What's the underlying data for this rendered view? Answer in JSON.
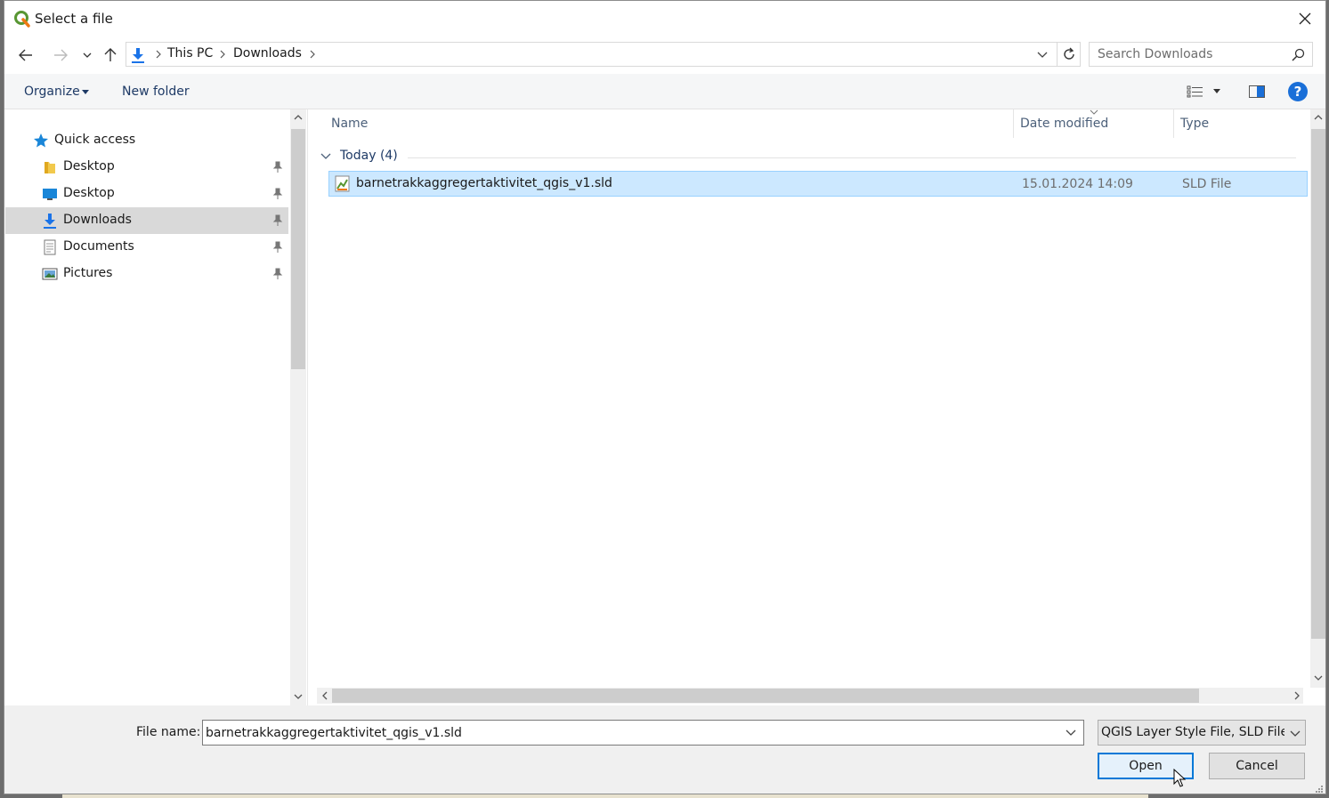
{
  "window": {
    "title": "Select a file"
  },
  "navigation": {
    "back_icon": "back-arrow-icon",
    "forward_icon": "forward-arrow-icon",
    "recent_icon": "chevron-down-icon",
    "up_icon": "up-arrow-icon",
    "breadcrumb": [
      "This PC",
      "Downloads"
    ],
    "search_placeholder": "Search Downloads"
  },
  "toolbar": {
    "organize": "Organize",
    "new_folder": "New folder"
  },
  "sidebar": {
    "items": [
      {
        "label": "Quick access",
        "icon": "star-icon"
      },
      {
        "label": "Desktop",
        "icon": "folder-icon"
      },
      {
        "label": "Desktop",
        "icon": "desktop-icon"
      },
      {
        "label": "Downloads",
        "icon": "download-icon"
      },
      {
        "label": "Documents",
        "icon": "document-icon"
      },
      {
        "label": "Pictures",
        "icon": "pictures-icon"
      }
    ]
  },
  "files": {
    "columns": {
      "name": "Name",
      "date": "Date modified",
      "type": "Type"
    },
    "group": "Today (4)",
    "rows": [
      {
        "name": "barnetrakkaggregertaktivitet_qgis_v1.sld",
        "date": "15.01.2024 14:09",
        "type": "SLD File"
      }
    ]
  },
  "footer": {
    "file_name_label": "File name:",
    "file_name_value": "barnetrakkaggregertaktivitet_qgis_v1.sld",
    "filter": "QGIS Layer Style File, SLD File (*",
    "open": "Open",
    "cancel": "Cancel"
  },
  "colors": {
    "accent": "#0078d7",
    "selection": "#cce8ff",
    "link": "#1e3a66"
  }
}
